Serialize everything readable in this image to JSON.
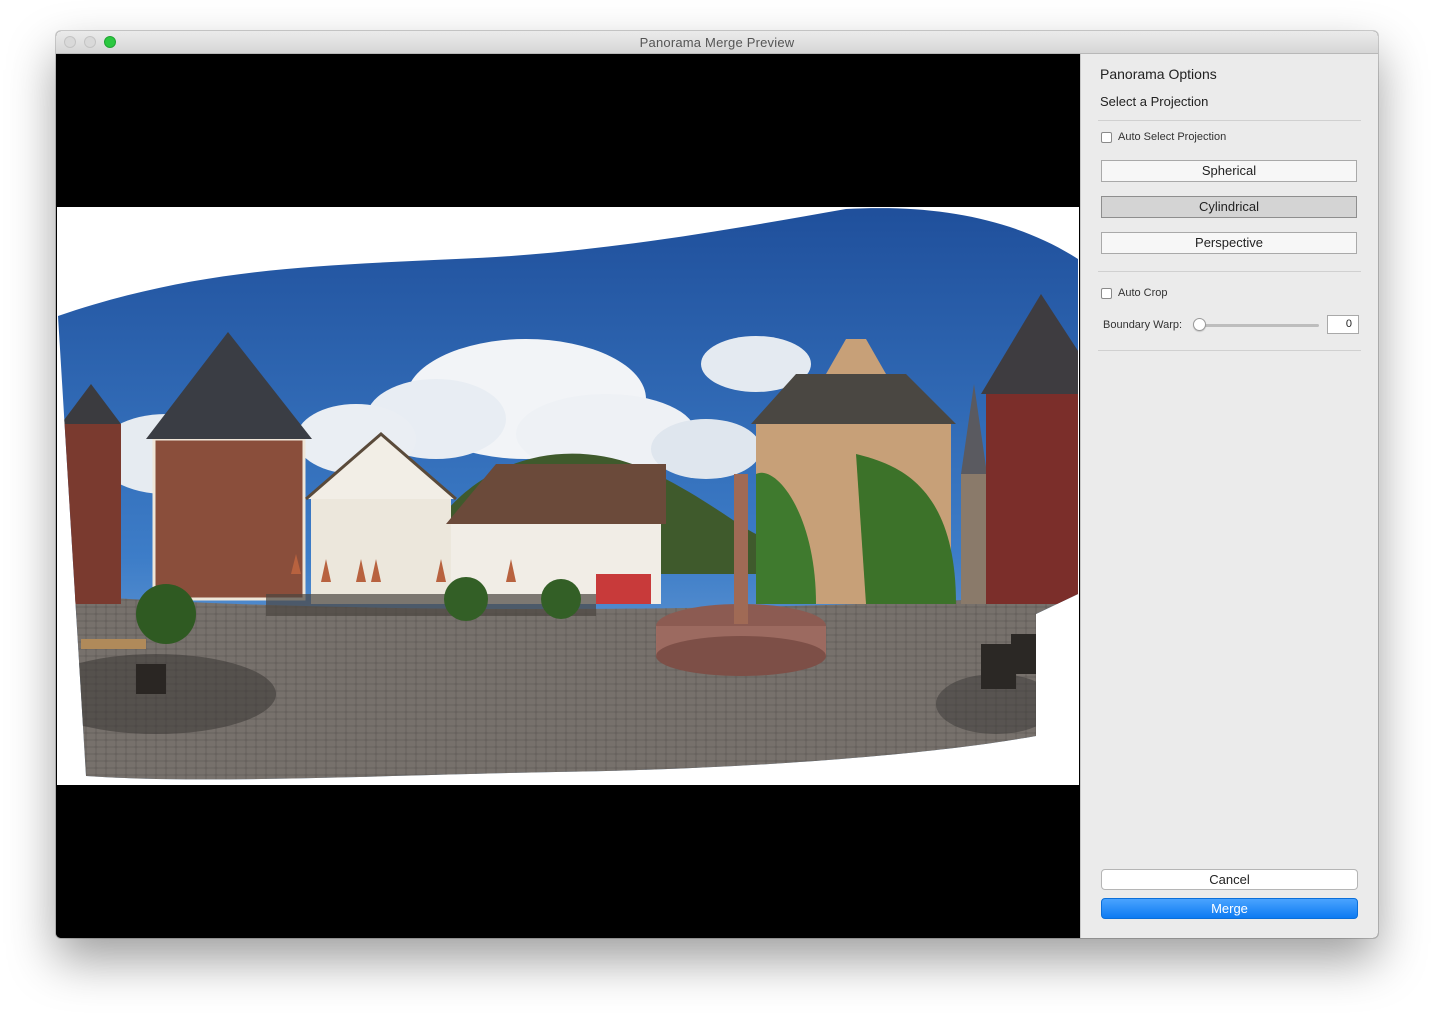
{
  "window": {
    "title": "Panorama Merge Preview"
  },
  "sidebar": {
    "heading": "Panorama Options",
    "subheading": "Select a Projection",
    "auto_select_label": "Auto Select Projection",
    "auto_select_checked": false,
    "projections": [
      "Spherical",
      "Cylindrical",
      "Perspective"
    ],
    "selected_projection": "Cylindrical",
    "auto_crop_label": "Auto Crop",
    "auto_crop_checked": false,
    "boundary_warp_label": "Boundary Warp:",
    "boundary_warp_value": "0",
    "cancel_label": "Cancel",
    "merge_label": "Merge"
  },
  "colors": {
    "accent": "#1a84f6",
    "sidebar_bg": "#ebebeb",
    "zoom_button": "#2bc840"
  }
}
